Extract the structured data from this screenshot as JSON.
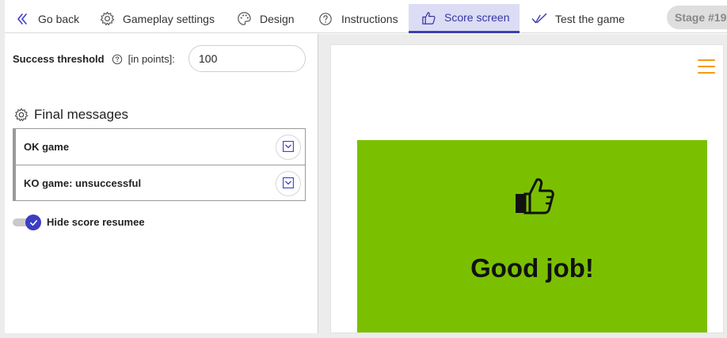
{
  "nav": {
    "back_label": "Go back",
    "tabs": [
      {
        "label": "Gameplay settings",
        "icon": "gear-icon"
      },
      {
        "label": "Design",
        "icon": "palette-icon"
      },
      {
        "label": "Instructions",
        "icon": "question-icon"
      },
      {
        "label": "Score screen",
        "icon": "thumbs-up-icon",
        "active": true
      },
      {
        "label": "Test the game",
        "icon": "check-icon"
      }
    ],
    "stage_label": "Stage #19"
  },
  "settings": {
    "threshold_label": "Success threshold",
    "threshold_unit": "[in points]:",
    "threshold_value": "100",
    "final_messages_title": "Final messages",
    "messages": [
      {
        "label": "OK game"
      },
      {
        "label": "KO game: unsuccessful"
      }
    ],
    "hide_score_label": "Hide score resumee",
    "hide_score_enabled": true
  },
  "preview": {
    "card_title": "Good job!",
    "card_color": "#7ac000",
    "menu_color": "#f59a18"
  },
  "colors": {
    "accent": "#3d3dc4",
    "active_tab_bg": "#dcdcf4"
  }
}
